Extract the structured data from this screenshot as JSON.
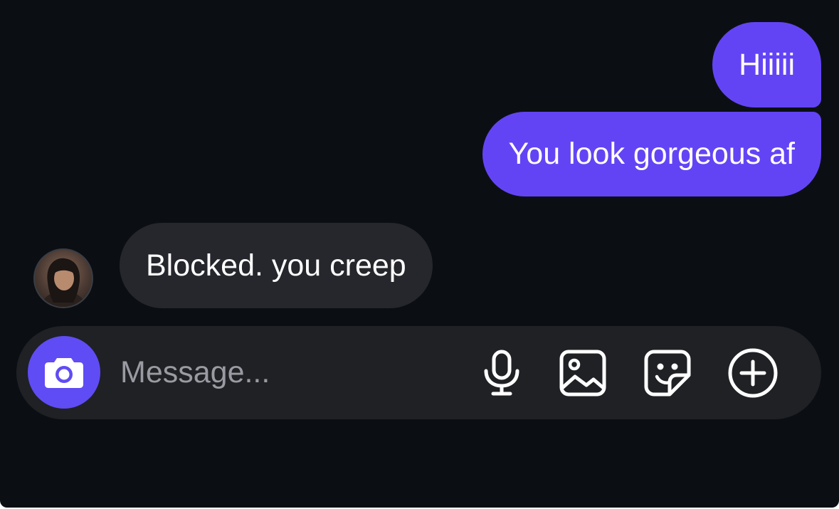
{
  "messages": [
    {
      "direction": "outgoing",
      "text": "Hiiiii"
    },
    {
      "direction": "outgoing",
      "text": "You look gorgeous af"
    },
    {
      "direction": "incoming",
      "text": "Blocked. you creep"
    }
  ],
  "composer": {
    "placeholder": "Message...",
    "value": "",
    "icons": [
      "camera-icon",
      "microphone-icon",
      "image-icon",
      "sticker-icon",
      "plus-icon"
    ]
  },
  "colors": {
    "background": "#0b0f14",
    "outgoing_bubble": "#6344f5",
    "incoming_bubble": "#25272c",
    "composer_bg": "#1f2125",
    "camera_button": "#5f4cf4",
    "placeholder_text": "#9a9ba2"
  }
}
